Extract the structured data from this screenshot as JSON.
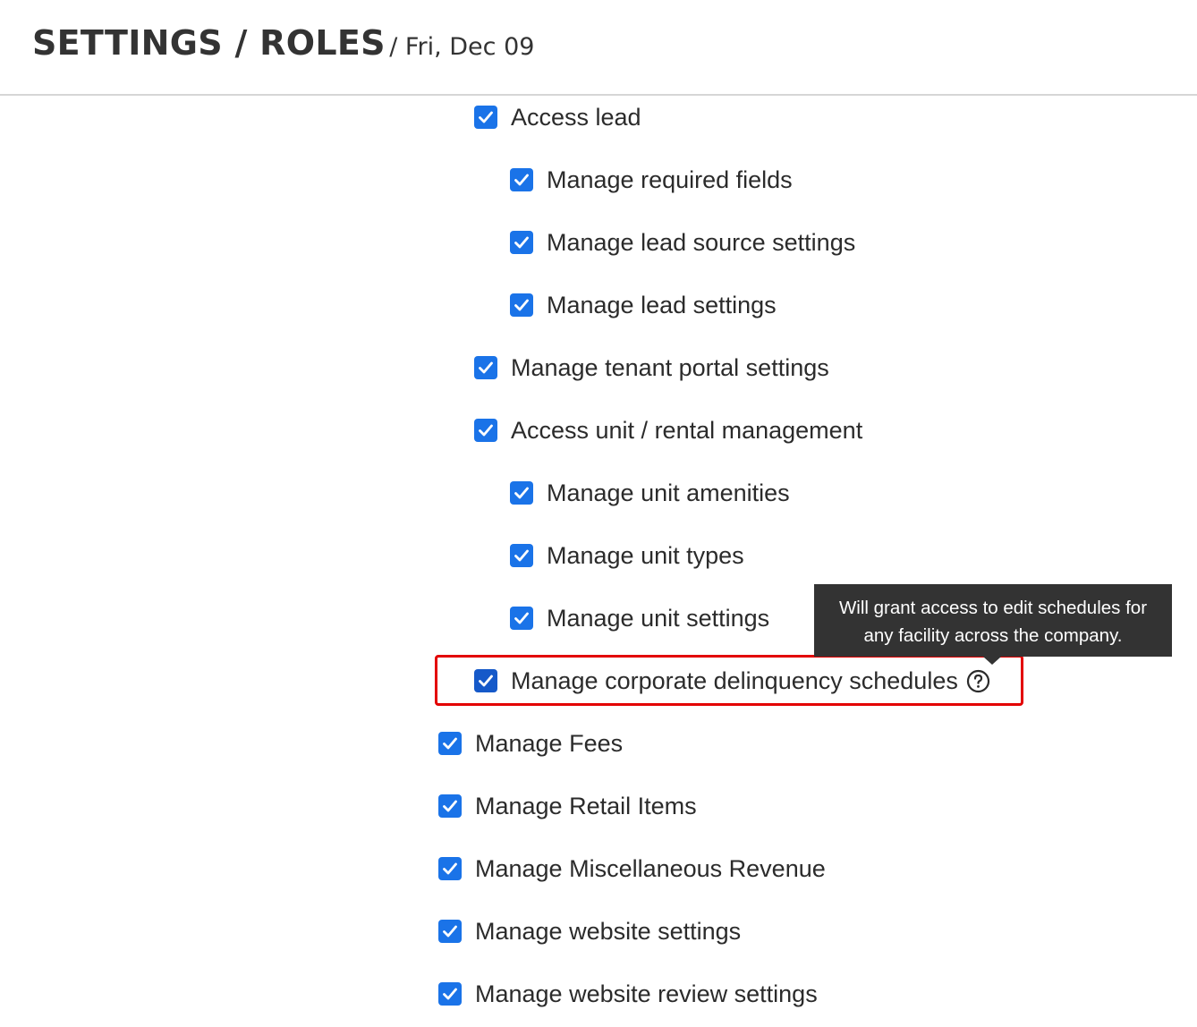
{
  "header": {
    "title": "SETTINGS / ROLES",
    "date": "/ Fri, Dec 09"
  },
  "permissions": [
    {
      "label": "Access lead",
      "checked": true
    },
    {
      "label": "Manage required fields",
      "checked": true
    },
    {
      "label": "Manage lead source settings",
      "checked": true
    },
    {
      "label": "Manage lead settings",
      "checked": true
    },
    {
      "label": "Manage tenant portal settings",
      "checked": true
    },
    {
      "label": "Access unit / rental management",
      "checked": true
    },
    {
      "label": "Manage unit amenities",
      "checked": true
    },
    {
      "label": "Manage unit types",
      "checked": true
    },
    {
      "label": "Manage unit settings",
      "checked": true
    },
    {
      "label": "Manage corporate delinquency schedules",
      "checked": true,
      "help_icon": "question-circle-icon"
    },
    {
      "label": "Manage Fees",
      "checked": true
    },
    {
      "label": "Manage Retail Items",
      "checked": true
    },
    {
      "label": "Manage Miscellaneous Revenue",
      "checked": true
    },
    {
      "label": "Manage website settings",
      "checked": true
    },
    {
      "label": "Manage website review settings",
      "checked": true
    }
  ],
  "tooltip": {
    "line1": "Will grant access to edit schedules for",
    "line2": "any facility across the company."
  },
  "colors": {
    "checkbox": "#1a73e8",
    "highlight_border": "#e30000",
    "tooltip_bg": "#333333"
  }
}
